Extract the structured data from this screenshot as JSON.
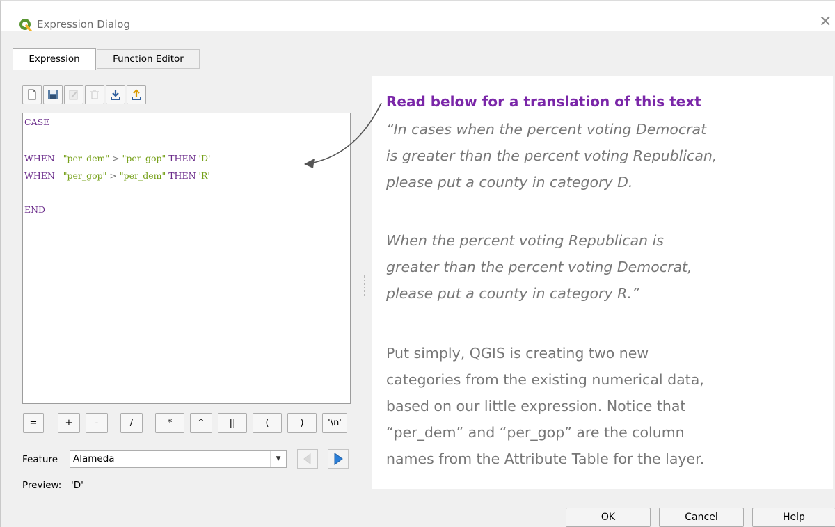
{
  "window": {
    "title": "Expression Dialog",
    "close_glyph": "✕"
  },
  "tabs": [
    {
      "label": "Expression",
      "active": true
    },
    {
      "label": "Function Editor",
      "active": false
    }
  ],
  "toolbar": {
    "icons": [
      "new-file-icon",
      "save-icon",
      "edit-icon",
      "delete-icon",
      "import-icon",
      "export-icon"
    ]
  },
  "editor": {
    "lines": [
      {
        "keyword": "CASE"
      },
      {
        "keyword": "WHEN",
        "field1": "\"per_dem\"",
        "op": ">",
        "field2": "\"per_gop\"",
        "then": "THEN",
        "value": "'D'"
      },
      {
        "keyword": "WHEN",
        "field1": "\"per_gop\"",
        "op": ">",
        "field2": "\"per_dem\"",
        "then": "THEN",
        "value": "'R'"
      },
      {
        "keyword": "END"
      }
    ]
  },
  "operators": [
    "=",
    "+",
    "-",
    "/",
    "*",
    "^",
    "||",
    "(",
    ")",
    "'\\n'"
  ],
  "feature": {
    "label": "Feature",
    "value": "Alameda"
  },
  "preview": {
    "label": "Preview:",
    "value": "'D'"
  },
  "buttons": {
    "ok": "OK",
    "cancel": "Cancel",
    "help": "Help"
  },
  "annotation": {
    "heading": "Read below for a translation of this text",
    "quote_lines": [
      "“In cases when the percent voting Democrat",
      "is greater than the percent voting Republican,",
      "please put a county in category D.",
      "",
      "When the percent voting Republican is",
      "greater than the percent voting Democrat,",
      "please put a county in category R.”"
    ],
    "body_lines": [
      "Put simply, QGIS is creating two new",
      "categories from the existing numerical data,",
      "based on our little expression. Notice that",
      "“per_dem” and “per_gop” are the column",
      "names from the Attribute Table for the layer."
    ]
  },
  "colors": {
    "accent": "#7a26a8",
    "keyword": "#6a2b8a",
    "string": "#76a019",
    "qgis_green": "#589632"
  }
}
